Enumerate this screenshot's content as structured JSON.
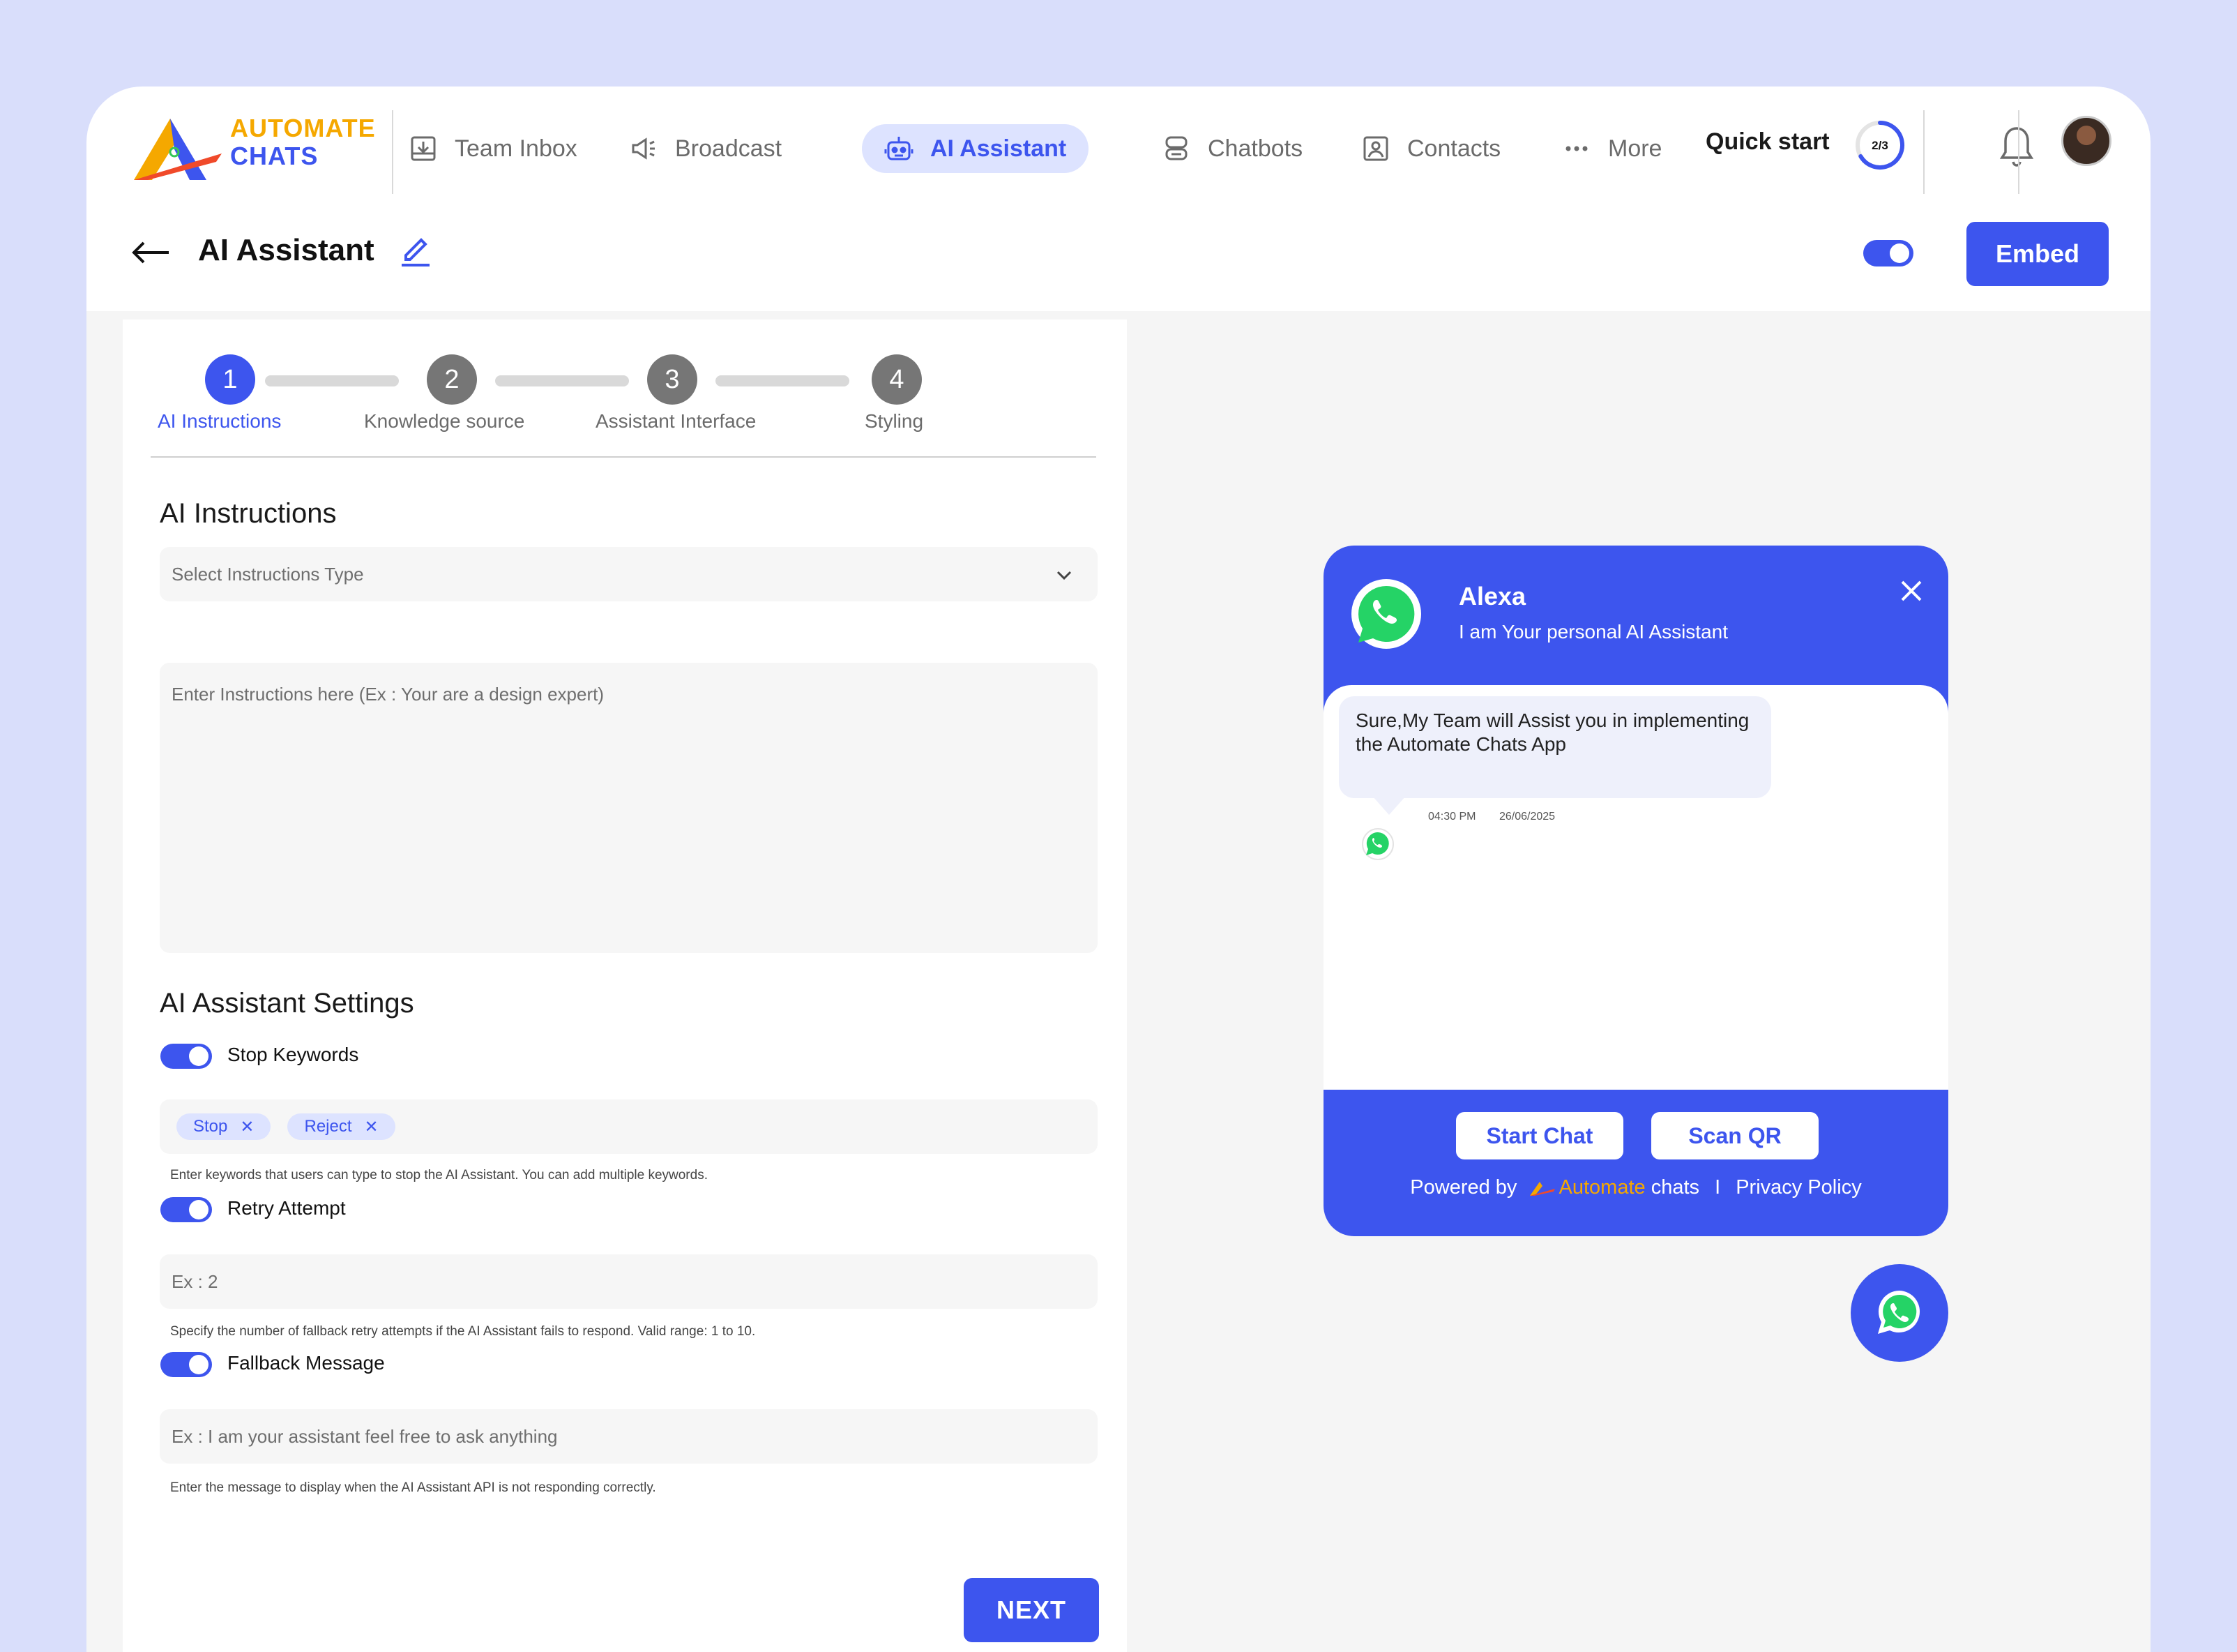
{
  "brand": {
    "line1": "AUTOMATE",
    "line2": "CHATS"
  },
  "nav": {
    "items": [
      {
        "label": "Team Inbox",
        "icon": "inbox-icon"
      },
      {
        "label": "Broadcast",
        "icon": "megaphone-icon"
      },
      {
        "label": "AI Assistant",
        "icon": "robot-icon",
        "active": true
      },
      {
        "label": "Chatbots",
        "icon": "chatbot-icon"
      },
      {
        "label": "Contacts",
        "icon": "contact-card-icon"
      },
      {
        "label": "More",
        "icon": "more-dots-icon"
      }
    ],
    "quick_start": "Quick start",
    "quick_start_progress": "2/3"
  },
  "header": {
    "title": "AI Assistant",
    "embed_label": "Embed",
    "widget_enabled": true
  },
  "stepper": {
    "steps": [
      {
        "num": "1",
        "label": "AI Instructions",
        "active": true
      },
      {
        "num": "2",
        "label": "Knowledge source"
      },
      {
        "num": "3",
        "label": "Assistant Interface"
      },
      {
        "num": "4",
        "label": "Styling"
      }
    ]
  },
  "instructions": {
    "title": "AI Instructions",
    "select_placeholder": "Select Instructions Type",
    "textarea_placeholder": "Enter Instructions here (Ex : Your are a design expert)"
  },
  "settings": {
    "title": "AI Assistant Settings",
    "stop_keywords": {
      "label": "Stop Keywords",
      "enabled": true,
      "chips": [
        "Stop",
        "Reject"
      ],
      "help": "Enter keywords that users can type to stop the AI Assistant. You can add multiple keywords."
    },
    "retry": {
      "label": "Retry Attempt",
      "enabled": true,
      "placeholder": "Ex : 2",
      "help": "Specify the number of fallback retry attempts if the AI Assistant fails to respond. Valid range: 1 to 10."
    },
    "fallback": {
      "label": "Fallback Message",
      "enabled": true,
      "placeholder": "Ex : I am your assistant feel free to ask anything",
      "help": "Enter the message to display when the AI Assistant API is not responding correctly."
    },
    "next_label": "NEXT"
  },
  "widget": {
    "agent_name": "Alexa",
    "agent_subtitle": "I am Your personal AI Assistant",
    "message": "Sure,My Team will Assist you in implementing the Automate Chats App",
    "time": "04:30 PM",
    "date": "26/06/2025",
    "start_chat": "Start Chat",
    "scan_qr": "Scan QR",
    "powered_by": "Powered by",
    "powered_brand_a": "Automate",
    "powered_brand_b": " chats",
    "separator": "I",
    "privacy": "Privacy Policy"
  },
  "colors": {
    "accent": "#3d55ee",
    "brand_yellow": "#f5a800",
    "whatsapp_green": "#25d366"
  }
}
